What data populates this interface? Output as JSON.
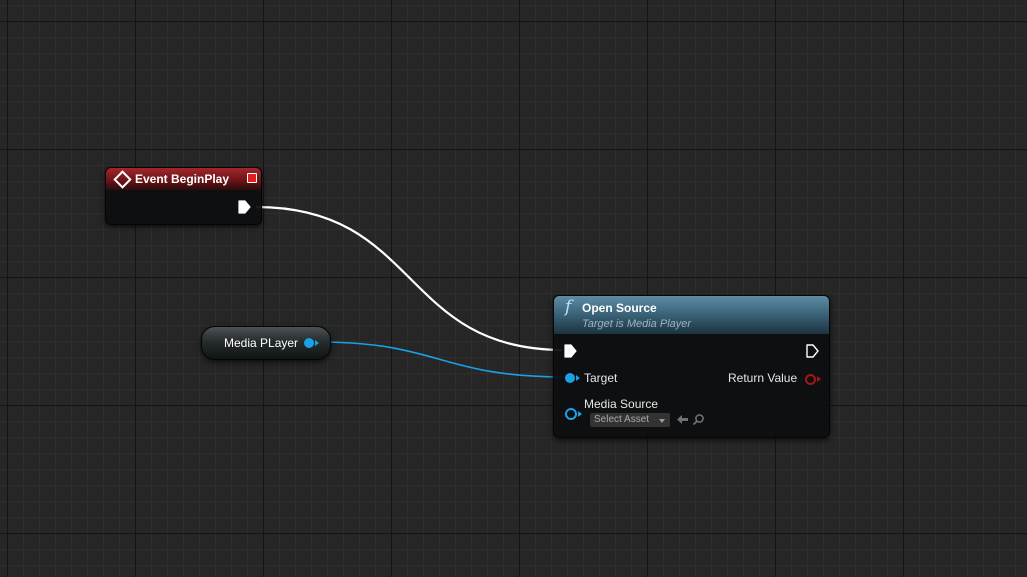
{
  "graph": {
    "nodes": {
      "event_begin_play": {
        "title": "Event BeginPlay",
        "header_color": "#8e1d21"
      },
      "media_player_variable": {
        "label": "Media PLayer",
        "pin_color": "#1aa1e8"
      },
      "open_source": {
        "title": "Open Source",
        "subtitle": "Target is Media Player",
        "header_color": "#4a7890",
        "pins": {
          "target": "Target",
          "media_source": "Media Source",
          "return_value": "Return Value"
        },
        "media_source_default": "Select Asset"
      }
    },
    "wires": {
      "exec_color": "#ffffff",
      "object_color": "#1aa1e8"
    }
  }
}
